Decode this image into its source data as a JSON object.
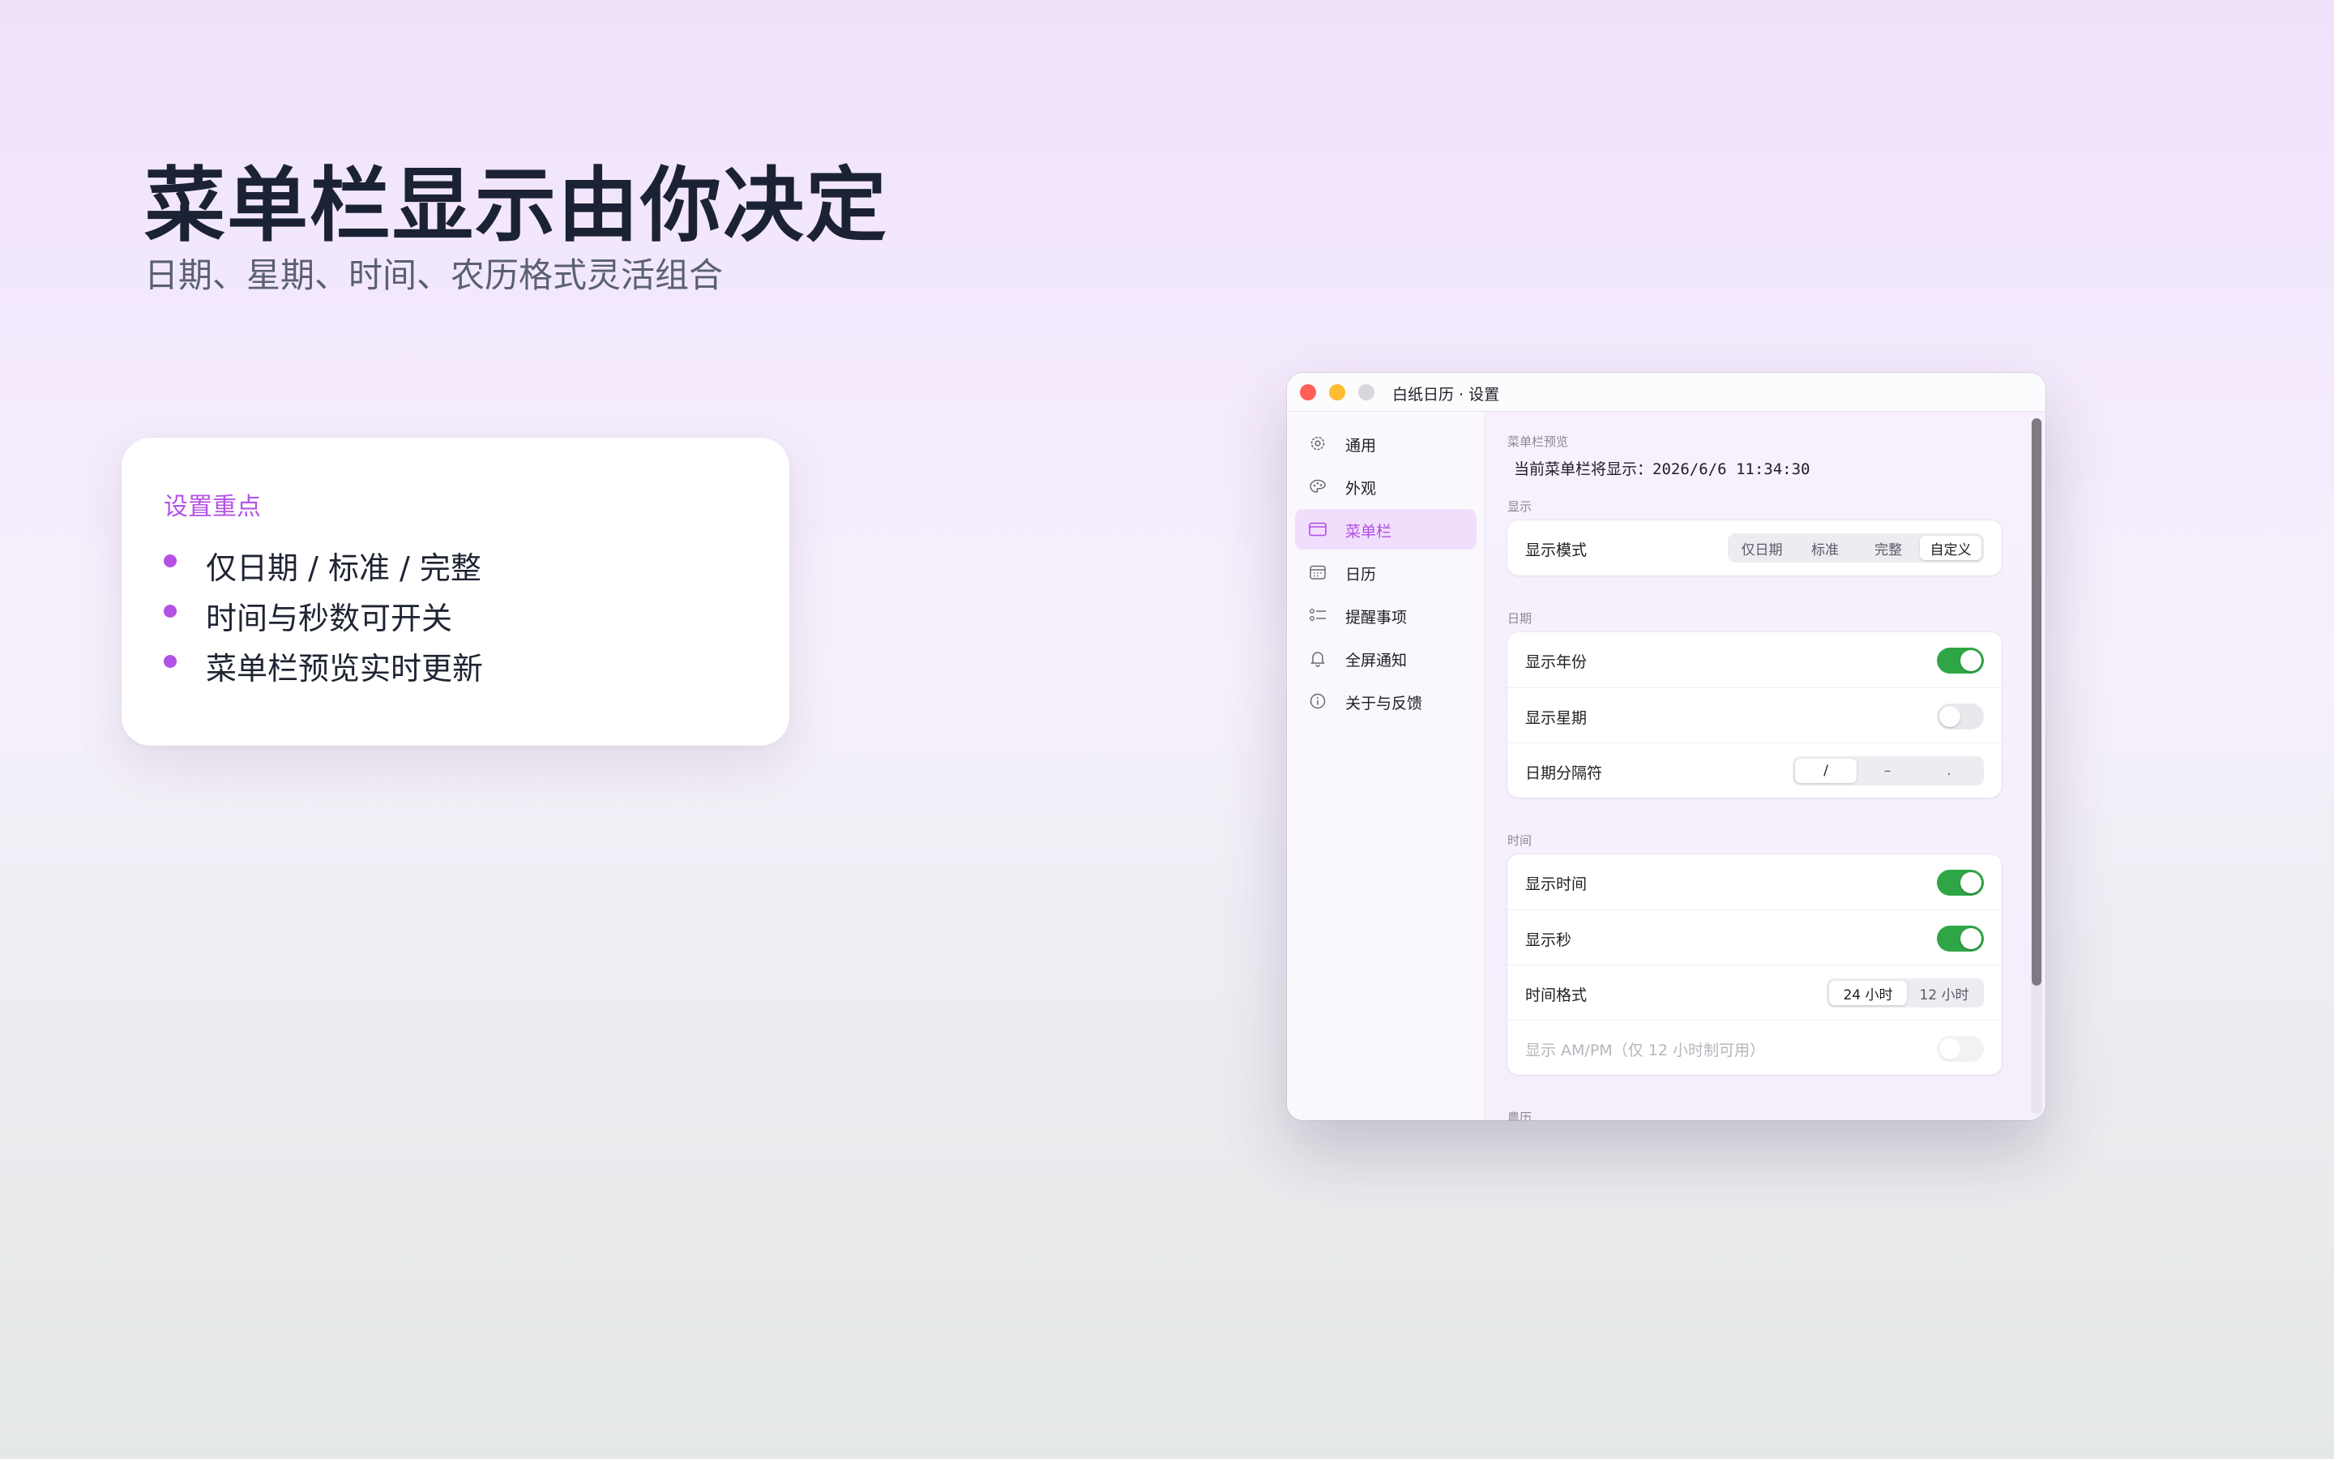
{
  "hero": {
    "title": "菜单栏显示由你决定",
    "subtitle": "日期、星期、时间、农历格式灵活组合"
  },
  "card": {
    "title": "设置重点",
    "items": [
      "仅日期 / 标准 / 完整",
      "时间与秒数可开关",
      "菜单栏预览实时更新"
    ]
  },
  "window": {
    "title": "白纸日历 · 设置",
    "sidebar": [
      {
        "label": "通用",
        "icon": "gear-icon"
      },
      {
        "label": "外观",
        "icon": "palette-icon"
      },
      {
        "label": "菜单栏",
        "icon": "menubar-icon",
        "active": true
      },
      {
        "label": "日历",
        "icon": "calendar-icon"
      },
      {
        "label": "提醒事项",
        "icon": "checklist-icon"
      },
      {
        "label": "全屏通知",
        "icon": "bell-icon"
      },
      {
        "label": "关于与反馈",
        "icon": "info-icon"
      }
    ],
    "preview": {
      "section": "菜单栏预览",
      "prefix": "当前菜单栏将显示：",
      "value": "2026/6/6 11:34:30"
    },
    "display": {
      "section": "显示",
      "mode_label": "显示模式",
      "mode_options": [
        "仅日期",
        "标准",
        "完整",
        "自定义"
      ],
      "mode_selected": "自定义"
    },
    "date": {
      "section": "日期",
      "show_year": {
        "label": "显示年份",
        "on": true
      },
      "show_weekday": {
        "label": "显示星期",
        "on": false
      },
      "separator_label": "日期分隔符",
      "separator_options": [
        "/",
        "–",
        "."
      ],
      "separator_selected": "/"
    },
    "time": {
      "section": "时间",
      "show_time": {
        "label": "显示时间",
        "on": true
      },
      "show_seconds": {
        "label": "显示秒",
        "on": true
      },
      "format_label": "时间格式",
      "format_options": [
        "24 小时",
        "12 小时"
      ],
      "format_selected": "24 小时",
      "ampm": {
        "label": "显示 AM/PM",
        "note": "（仅 12 小时制可用）",
        "on": false,
        "disabled": true
      }
    },
    "next_section": "農历"
  },
  "colors": {
    "accent": "#b452e6",
    "toggle_on": "#2fa646",
    "sidebar_active_bg": "#f1defc"
  }
}
